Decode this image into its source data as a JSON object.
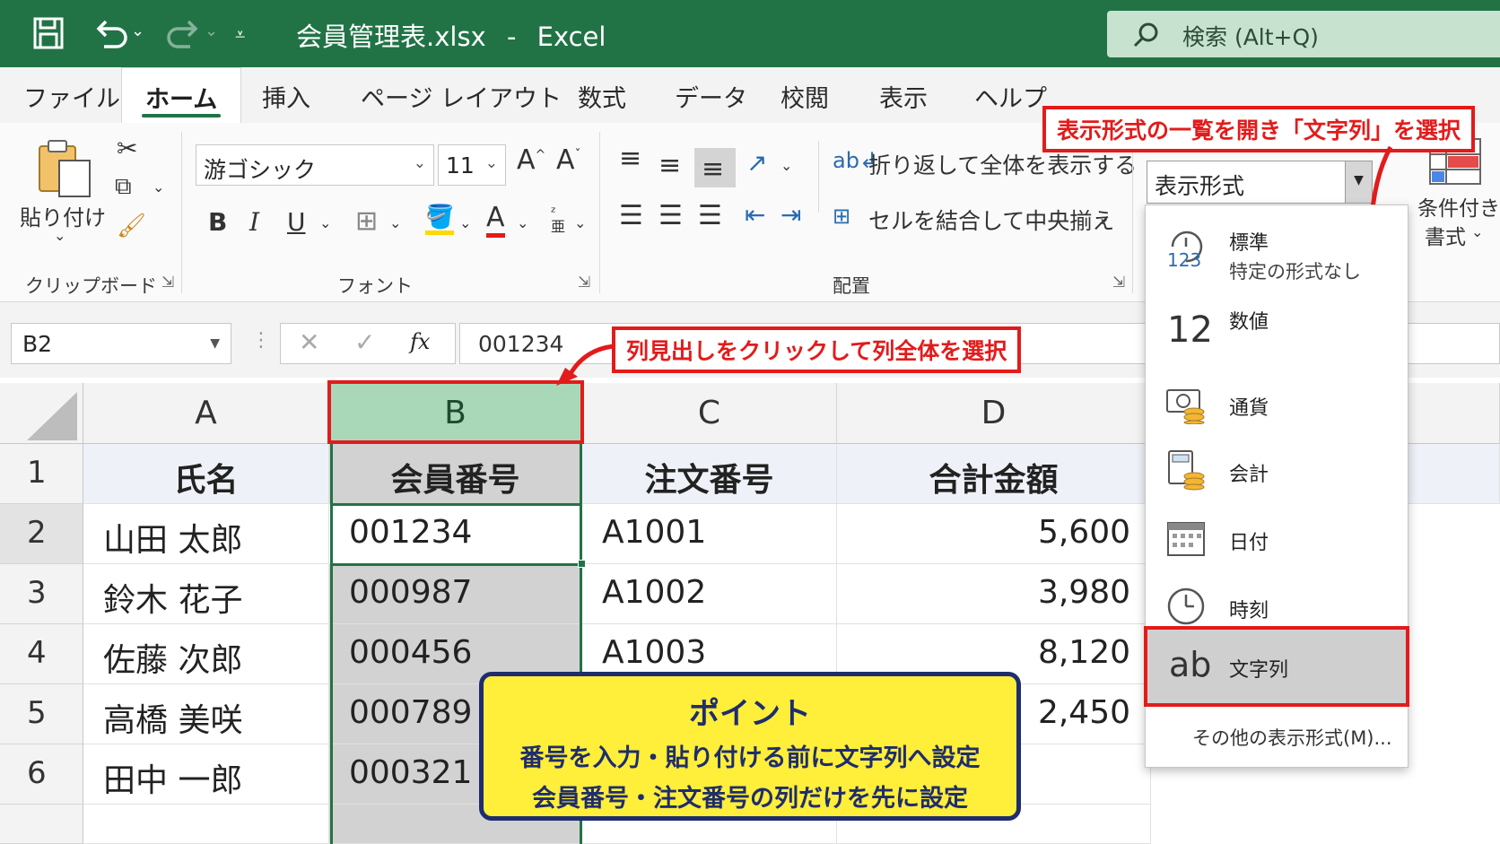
{
  "titlebar": {
    "filename": "会員管理表.xlsx",
    "separator": "-",
    "app": "Excel",
    "search_text": "検索 (Alt+Q)"
  },
  "tabs": [
    "ファイル",
    "ホーム",
    "挿入",
    "ページ レイアウト",
    "数式",
    "データ",
    "校閲",
    "表示",
    "ヘルプ"
  ],
  "active_tab": "ホーム",
  "ribbon": {
    "clipboard": {
      "paste_label": "貼り付け",
      "group_label": "クリップボード"
    },
    "font": {
      "font_name": "游ゴシック",
      "font_size": "11",
      "grow": "A",
      "shrink": "A",
      "bold": "B",
      "italic": "I",
      "underline": "U",
      "font_color_letter": "A",
      "group_label": "フォント"
    },
    "alignment": {
      "wrap_text": "折り返して全体を表示する",
      "merge_center": "セルを結合して中央揃え",
      "group_label": "配置"
    },
    "number": {
      "format_value": "表示形式"
    },
    "styles": {
      "conditional_line1": "条件付き",
      "conditional_line2": "書式"
    }
  },
  "formula_bar": {
    "name_box": "B2",
    "fx": "fx",
    "content": "001234"
  },
  "sheet": {
    "columns": [
      "A",
      "B",
      "C",
      "D"
    ],
    "rows": [
      "1",
      "2",
      "3",
      "4",
      "5",
      "6"
    ],
    "header_row": [
      "氏名",
      "会員番号",
      "注文番号",
      "合計金額"
    ],
    "data": [
      [
        "山田 太郎",
        "001234",
        "A1001",
        "5,600"
      ],
      [
        "鈴木 花子",
        "000987",
        "A1002",
        "3,980"
      ],
      [
        "佐藤 次郎",
        "000456",
        "A1003",
        "8,120"
      ],
      [
        "高橋 美咲",
        "000789",
        "",
        "2,450"
      ],
      [
        "田中 一郎",
        "000321",
        "",
        ""
      ]
    ]
  },
  "number_format_menu": {
    "items": [
      {
        "label": "標準",
        "sub": "特定の形式なし",
        "icon": "clock-123-icon"
      },
      {
        "label": "数値",
        "icon": "number-12-icon",
        "glyph": "12"
      },
      {
        "label": "通貨",
        "icon": "currency-icon"
      },
      {
        "label": "会計",
        "icon": "accounting-icon"
      },
      {
        "label": "日付",
        "icon": "calendar-icon"
      },
      {
        "label": "時刻",
        "icon": "clock-icon"
      },
      {
        "label": "文字列",
        "icon": "text-ab-icon",
        "glyph": "ab"
      }
    ],
    "more": "その他の表示形式(M)..."
  },
  "annotations": {
    "top_callout": "表示形式の一覧を開き「文字列」を選択",
    "column_callout": "列見出しをクリックして列全体を選択",
    "point_title": "ポイント",
    "point_line1": "番号を入力・貼り付ける前に文字列へ設定",
    "point_line2": "会員番号・注文番号の列だけを先に設定"
  },
  "colors": {
    "excel_green": "#217346",
    "highlight_red": "#e31b1b",
    "point_yellow": "#ffee3a",
    "point_navy": "#1e2d6e"
  }
}
